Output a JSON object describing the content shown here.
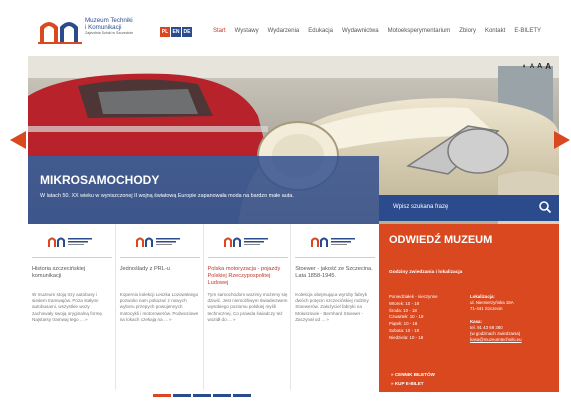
{
  "logo": {
    "line1": "Muzeum Techniki",
    "line2": "i Komunikacji",
    "line3": "Zajezdnia Sztuki w Szczecinie"
  },
  "languages": [
    {
      "label": "PL",
      "color": "#d9481f"
    },
    {
      "label": "EN",
      "color": "#2c4b8c"
    },
    {
      "label": "DE",
      "color": "#2c4b8c"
    }
  ],
  "nav": [
    {
      "label": "Start",
      "active": true
    },
    {
      "label": "Wystawy",
      "active": false
    },
    {
      "label": "Wydarzenia",
      "active": false
    },
    {
      "label": "Edukacja",
      "active": false
    },
    {
      "label": "Wydawnictwa",
      "active": false
    },
    {
      "label": "Motoeksperymentarium",
      "active": false
    },
    {
      "label": "Zbiory",
      "active": false
    },
    {
      "label": "Kontakt",
      "active": false
    },
    {
      "label": "E-BILETY",
      "active": false
    }
  ],
  "accessibility": {
    "contrast_icon": "contrast-icon",
    "sizes": [
      "A",
      "A",
      "A"
    ]
  },
  "hero": {
    "title": "MIKROSAMOCHODY",
    "text": "W latach 50. XX wieku w wyniszczonej II wojną światową Europie zapanowała moda na bardzo małe auta."
  },
  "search": {
    "placeholder": "Wpisz szukana frazę"
  },
  "cards": [
    {
      "title": "Historia szczecińskiej komunikacji",
      "red": false,
      "text": "W muzeum stoją trzy autobusy i siedem tramwajów. Poza stałymi autobusami, wszystkie wozy zachowały swoją oryginalną formę. Najstarsy tramwaj tego ... »"
    },
    {
      "title": "Jednoślady z PRL-u",
      "red": false,
      "text": "Kopernio kolekcji Leszka Lozowskiego pozwolio nam pokazać z nowych wyboru przepych powojennych motocykli i motorowerów. Podwoziowe na lokach czekają na ... »"
    },
    {
      "title": "Polska motoryzacja - pojazdy Polskiej Rzeczypospolitej Ludowej",
      "red": true,
      "text": "Tym samochodom wozimy możemy się dziwić. Jest niemożliwym świadectwem wysokiego poziomu polskiej myśli technicznej. Co prawda świadczy też wozidł do ... »"
    },
    {
      "title": "Stoewer - jakość ze Szczecina. Lata 1858-1945.",
      "red": false,
      "text": "Kolekcja obejmująca wyroby fabryk dwóch potęcin szczecińskiej rodziny Stoewerów. Założyciel fabryki na Mołuszowie - Bernhard Stoewer - Zaczynał od ... »"
    }
  ],
  "visit": {
    "title": "ODWIEDŹ MUZEUM",
    "subtitle": "Godziny zwiedzania i lokalizacja",
    "hours": [
      "Poniedziałek - nieczynne",
      "Wtorek: 10 - 18",
      "Środa: 10 - 18",
      "Czwartek: 10 - 18",
      "Piątek: 10 - 18",
      "Sobota: 10 - 18",
      "Niedziela: 10 - 18"
    ],
    "loc_label": "Lokalizacja:",
    "address1": "ul. Niemierzyńska 18A",
    "address2": "71-441 Szczecin",
    "contact_label": "Kasa:",
    "phone": "tel. 91 43 69 380",
    "phone_note": "(w godzinach zwiedzania)",
    "email": "kasa@muzeumtechniki.eu",
    "link1": "» CENNIK BILETÓW",
    "link2": "» KUP E-BILET"
  },
  "pager": {
    "count": 5,
    "active": 0
  }
}
